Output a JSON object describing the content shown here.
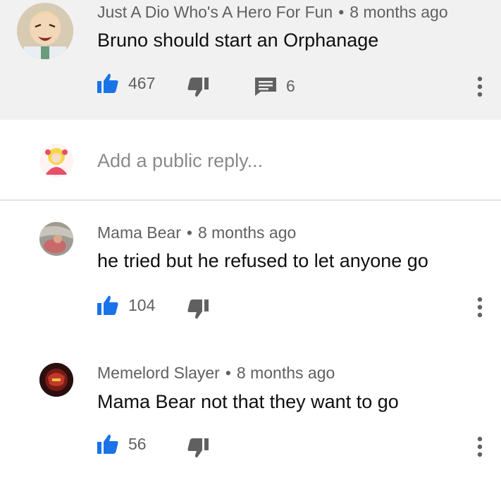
{
  "top_comment": {
    "author": "Just A Dio Who's A Hero For Fun",
    "time": "8 months ago",
    "text": "Bruno should start an Orphanage",
    "likes": "467",
    "replies": "6"
  },
  "reply_box": {
    "placeholder": "Add a public reply..."
  },
  "replies": [
    {
      "author": "Mama Bear",
      "time": "8 months ago",
      "text": "he tried but he refused to let anyone go",
      "likes": "104"
    },
    {
      "author": "Memelord Slayer",
      "time": "8 months ago",
      "text": "Mama Bear not that they want to go",
      "likes": "56"
    }
  ],
  "separator": "•",
  "colors": {
    "like_blue": "#1a73e8",
    "dislike_gray": "#606060",
    "meta_gray": "#606060"
  },
  "icons": [
    "thumbs-up-icon",
    "thumbs-down-icon",
    "reply-comment-icon",
    "more-vert-icon"
  ]
}
